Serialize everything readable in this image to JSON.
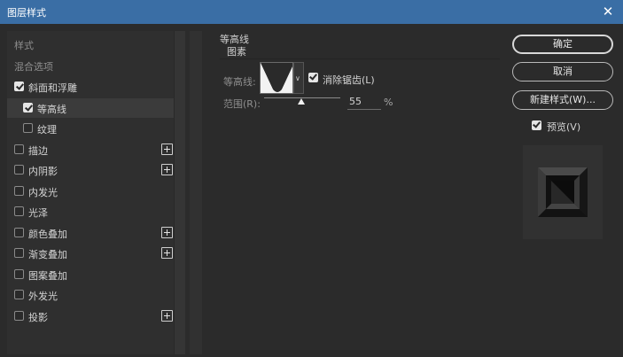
{
  "window": {
    "title": "图层样式",
    "close_glyph": "✕"
  },
  "sidebar": {
    "header_styles": "样式",
    "header_blending": "混合选项",
    "items": [
      {
        "label": "斜面和浮雕",
        "checked": true,
        "indent": 0,
        "plus": false
      },
      {
        "label": "等高线",
        "checked": true,
        "indent": 1,
        "plus": false,
        "selected": true
      },
      {
        "label": "纹理",
        "checked": false,
        "indent": 1,
        "plus": false
      },
      {
        "label": "描边",
        "checked": false,
        "indent": 0,
        "plus": true
      },
      {
        "label": "内阴影",
        "checked": false,
        "indent": 0,
        "plus": true
      },
      {
        "label": "内发光",
        "checked": false,
        "indent": 0,
        "plus": false
      },
      {
        "label": "光泽",
        "checked": false,
        "indent": 0,
        "plus": false
      },
      {
        "label": "颜色叠加",
        "checked": false,
        "indent": 0,
        "plus": true
      },
      {
        "label": "渐变叠加",
        "checked": false,
        "indent": 0,
        "plus": true
      },
      {
        "label": "图案叠加",
        "checked": false,
        "indent": 0,
        "plus": false
      },
      {
        "label": "外发光",
        "checked": false,
        "indent": 0,
        "plus": false
      },
      {
        "label": "投影",
        "checked": false,
        "indent": 0,
        "plus": true
      }
    ]
  },
  "contour_panel": {
    "group_title": "等高线",
    "sub_title": "图素",
    "contour_label": "等高线:",
    "antialias_label": "消除锯齿(L)",
    "antialias_checked": true,
    "range_label": "范围(R):",
    "range_value": "55",
    "range_percent": 55,
    "range_unit": "%",
    "dropdown_glyph": "∨"
  },
  "actions": {
    "ok": "确定",
    "cancel": "取消",
    "new_style": "新建样式(W)...",
    "preview_label": "预览(V)",
    "preview_checked": true
  },
  "colors": {
    "titlebar": "#3a6ea5",
    "background": "#2b2b2b",
    "panel": "#2f2f2f",
    "text": "#d4d4d4",
    "dim_text": "#8f8f8f"
  }
}
